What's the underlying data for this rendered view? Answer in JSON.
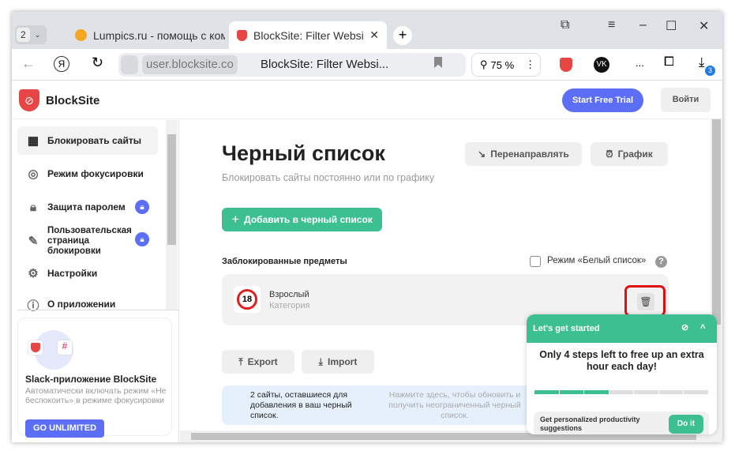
{
  "browser": {
    "tab_count": "2",
    "tabs": [
      {
        "label": "Lumpics.ru - помощь с ком"
      },
      {
        "label": "BlockSite: Filter Website"
      }
    ],
    "url_host": "user.blocksite.co",
    "page_title": "BlockSite: Filter Websi...",
    "zoom": "75 %",
    "downloads_badge": "3",
    "extensions_more": "..."
  },
  "app": {
    "logo": "BlockSite",
    "start_trial": "Start Free Trial",
    "login": "Войти",
    "brand_color": "#e84545",
    "accent_green": "#3cbf91",
    "accent_blue": "#5b6ef5"
  },
  "sidebar": {
    "items": [
      {
        "label": "Блокировать сайты",
        "icon": "grid-block-icon",
        "active": true
      },
      {
        "label": "Режим фокусировки",
        "icon": "target-icon"
      },
      {
        "label": "Защита паролем",
        "icon": "lock-icon",
        "locked": true
      },
      {
        "label": "Пользовательская страница блокировки",
        "icon": "edit-page-icon",
        "locked": true
      },
      {
        "label": "Настройки",
        "icon": "gear-icon"
      },
      {
        "label": "О приложении",
        "icon": "info-icon"
      }
    ],
    "promo": {
      "title": "Slack-приложение BlockSite",
      "text": "Автоматически включать режим «Не беспокоить» в режиме фокусировки",
      "button": "GO UNLIMITED"
    }
  },
  "main": {
    "title": "Черный список",
    "subtitle": "Блокировать сайты постоянно или по графику",
    "redirect": "Перенаправлять",
    "schedule": "График",
    "add": "Добавить в черный список",
    "blocked_header": "Заблокированные предметы",
    "whitelist_label": "Режим «Белый список»",
    "whitelist_checked": false,
    "items": [
      {
        "name": "Взрослый",
        "type": "Категория",
        "icon": "adult-18-icon"
      }
    ],
    "export": "Export",
    "import": "Import",
    "notice_left": "2 сайты, оставшиеся для добавления в ваш черный список.",
    "notice_right": "Нажмите здесь, чтобы обновить и получить неограниченный черный список."
  },
  "onboarding": {
    "header": "Let's get started",
    "headline": "Only 4 steps left to free up an extra hour each day!",
    "steps_total": 7,
    "steps_done": 3,
    "suggestion": "Get personalized productivity suggestions",
    "do_it": "Do it"
  }
}
